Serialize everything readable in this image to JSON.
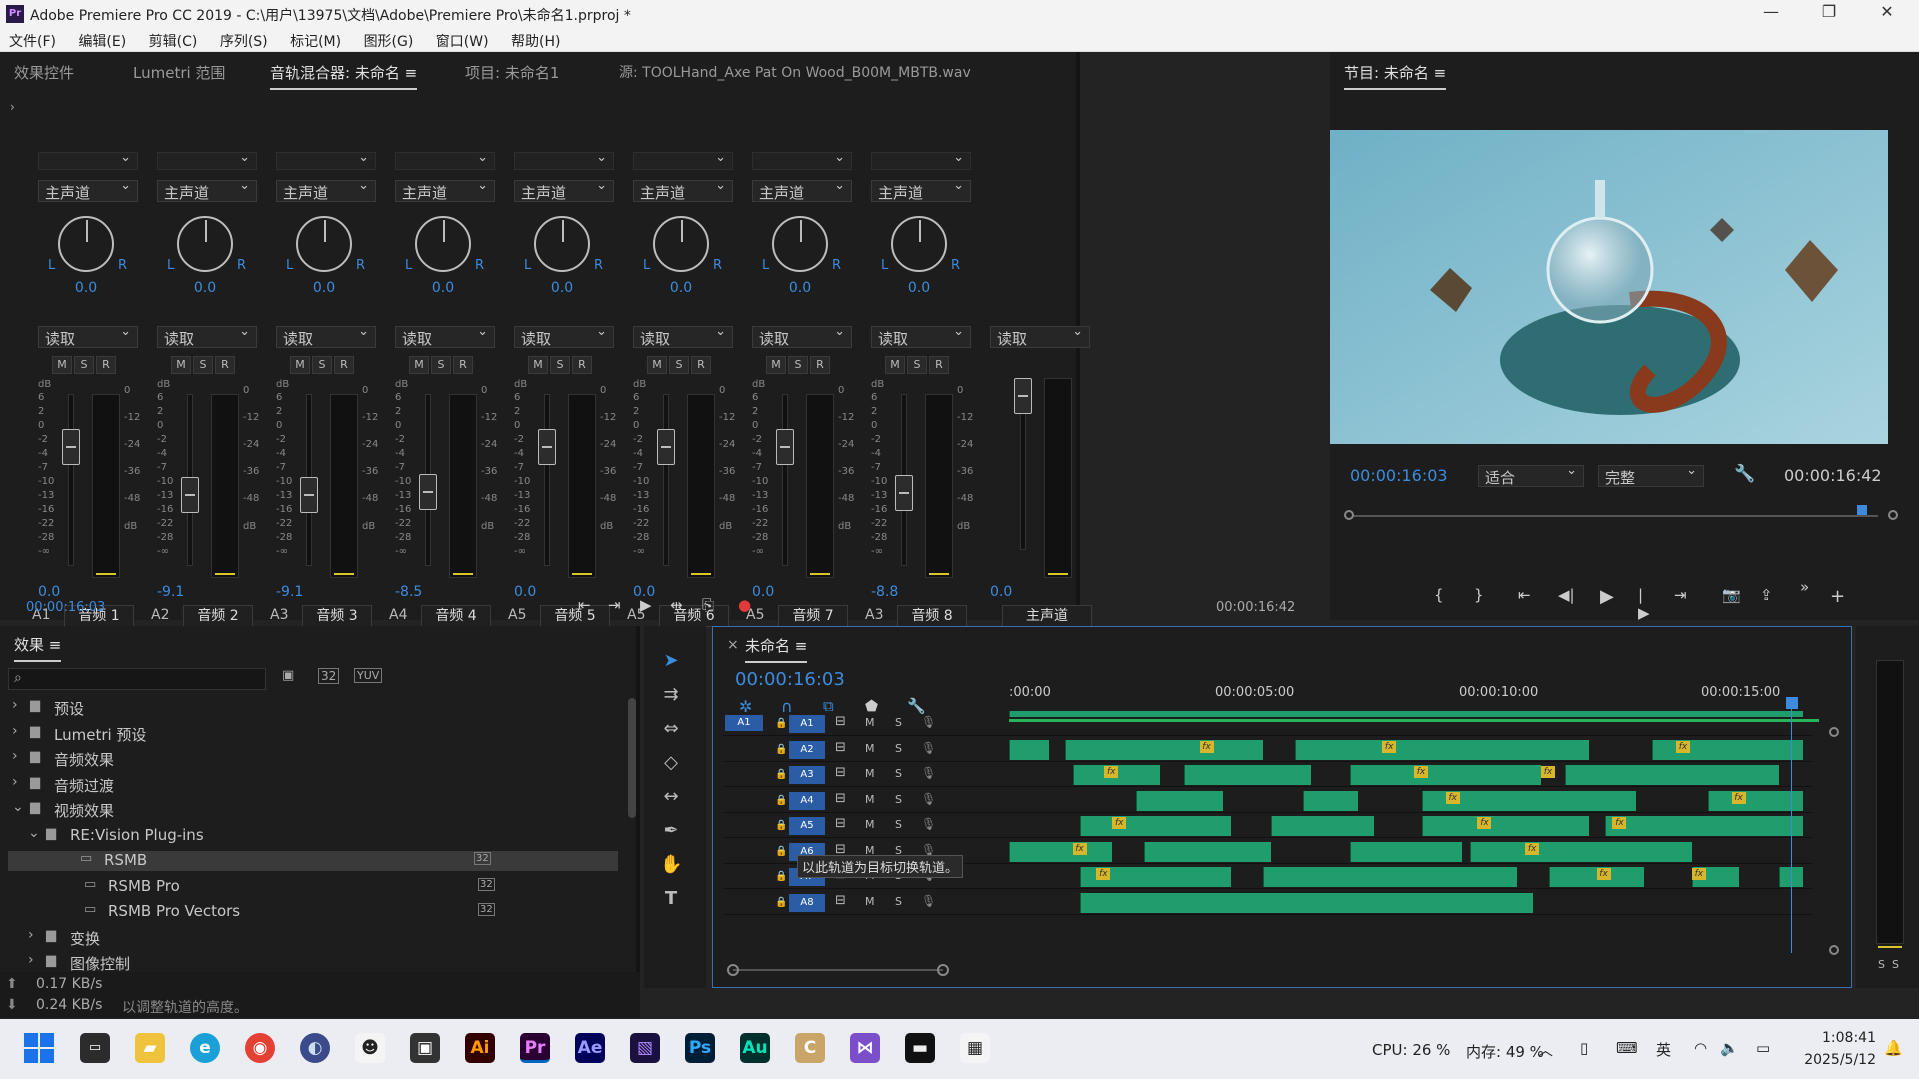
{
  "window": {
    "title": "Adobe Premiere Pro CC 2019 - C:\\用户\\13975\\文档\\Adobe\\Premiere Pro\\未命名1.prproj *",
    "min_icon": "minimize-icon",
    "max_icon": "restore-icon",
    "close_icon": "close-icon"
  },
  "menu": [
    "文件(F)",
    "编辑(E)",
    "剪辑(C)",
    "序列(S)",
    "标记(M)",
    "图形(G)",
    "窗口(W)",
    "帮助(H)"
  ],
  "top_tabs": {
    "effect_controls": "效果控件",
    "lumetri": "Lumetri 范围",
    "audio_mixer": "音轨混合器: 未命名",
    "project": "项目: 未命名1",
    "source": "源: TOOLHand_Axe Pat On Wood_B00M_MBTB.wav"
  },
  "mixer": {
    "channel_label": "主声道",
    "mode_label": "读取",
    "msr": [
      "M",
      "S",
      "R"
    ],
    "db_scale": [
      "dB",
      "6",
      "2",
      "0",
      "-2",
      "-4",
      "-7",
      "-10",
      "-13",
      "-16",
      "-22",
      "-28",
      "-∞"
    ],
    "meter_scale": [
      "0",
      "-12",
      "-24",
      "-36",
      "-48",
      "dB"
    ],
    "strips": [
      {
        "id": "A1",
        "name": "音频 1",
        "pan": "0.0",
        "vol": "0.0",
        "level": 0.77
      },
      {
        "id": "A2",
        "name": "音频 2",
        "pan": "0.0",
        "vol": "-9.1",
        "level": 0.45
      },
      {
        "id": "A3",
        "name": "音频 3",
        "pan": "0.0",
        "vol": "-9.1",
        "level": 0.45
      },
      {
        "id": "A4",
        "name": "音频 4",
        "pan": "0.0",
        "vol": "-8.5",
        "level": 0.47
      },
      {
        "id": "A5",
        "name": "音频 5",
        "pan": "0.0",
        "vol": "0.0",
        "level": 0.77
      },
      {
        "id": "A5",
        "name": "音频 6",
        "pan": "0.0",
        "vol": "0.0",
        "level": 0.77
      },
      {
        "id": "A5",
        "name": "音频 7",
        "pan": "0.0",
        "vol": "0.0",
        "level": 0.77
      },
      {
        "id": "A3",
        "name": "音频 8",
        "pan": "0.0",
        "vol": "-8.8",
        "level": 0.46
      }
    ],
    "master": {
      "name": "主声道",
      "vol": "0.0"
    },
    "timecode_left": "00:00:16:03",
    "timecode_right": "00:00:16:42"
  },
  "program": {
    "title": "节目: 未命名",
    "timecode": "00:00:16:03",
    "fit": "适合",
    "quality": "完整",
    "duration": "00:00:16:42",
    "playhead": 0.97
  },
  "effects": {
    "title": "效果",
    "search_placeholder": "",
    "tree": [
      {
        "label": "预设",
        "level": 0,
        "kind": "folder-preset"
      },
      {
        "label": "Lumetri 预设",
        "level": 0,
        "kind": "folder-preset"
      },
      {
        "label": "音频效果",
        "level": 0,
        "kind": "folder"
      },
      {
        "label": "音频过渡",
        "level": 0,
        "kind": "folder"
      },
      {
        "label": "视频效果",
        "level": 0,
        "kind": "folder-open"
      },
      {
        "label": "RE:Vision Plug-ins",
        "level": 1,
        "kind": "folder-open"
      },
      {
        "label": "RSMB",
        "level": 2,
        "kind": "effect",
        "selected": true
      },
      {
        "label": "RSMB Pro",
        "level": 2,
        "kind": "effect"
      },
      {
        "label": "RSMB Pro Vectors",
        "level": 2,
        "kind": "effect"
      },
      {
        "label": "变换",
        "level": 1,
        "kind": "folder"
      },
      {
        "label": "图像控制",
        "level": 1,
        "kind": "folder"
      }
    ],
    "badge": "32"
  },
  "status": {
    "net_up": "0.17 KB/s",
    "net_down": "0.24 KB/s",
    "hint": "以调整轨道的高度。"
  },
  "timeline": {
    "title": "未命名",
    "timecode": "00:00:16:03",
    "ruler": [
      ":00:00",
      "00:00:05:00",
      "00:00:10:00",
      "00:00:15:00"
    ],
    "tooltip": "以此轨道为目标切换轨道。",
    "source_patch": "A1",
    "tracks": [
      {
        "id": "A1",
        "fx": []
      },
      {
        "id": "A2",
        "fx": [
          0.24,
          0.47,
          0.84
        ]
      },
      {
        "id": "A3",
        "fx": [
          0.12,
          0.51,
          0.67
        ]
      },
      {
        "id": "A4",
        "fx": [
          0.55,
          0.91
        ]
      },
      {
        "id": "A5",
        "fx": [
          0.13,
          0.59,
          0.76
        ]
      },
      {
        "id": "A6",
        "fx": [
          0.08,
          0.65
        ]
      },
      {
        "id": "A7",
        "fx": [
          0.11,
          0.74,
          0.86
        ]
      },
      {
        "id": "A8",
        "fx": []
      }
    ],
    "track_buttons": [
      "M",
      "S"
    ],
    "meter_labels": [
      "S",
      "S"
    ]
  },
  "taskbar": {
    "apps": [
      "Ai",
      "Pr",
      "Ae",
      "Ps",
      "Au"
    ],
    "cpu": "CPU: 26 %",
    "mem": "内存: 49 %",
    "ime": "英",
    "time": "1:08:41",
    "date": "2025/5/12"
  }
}
